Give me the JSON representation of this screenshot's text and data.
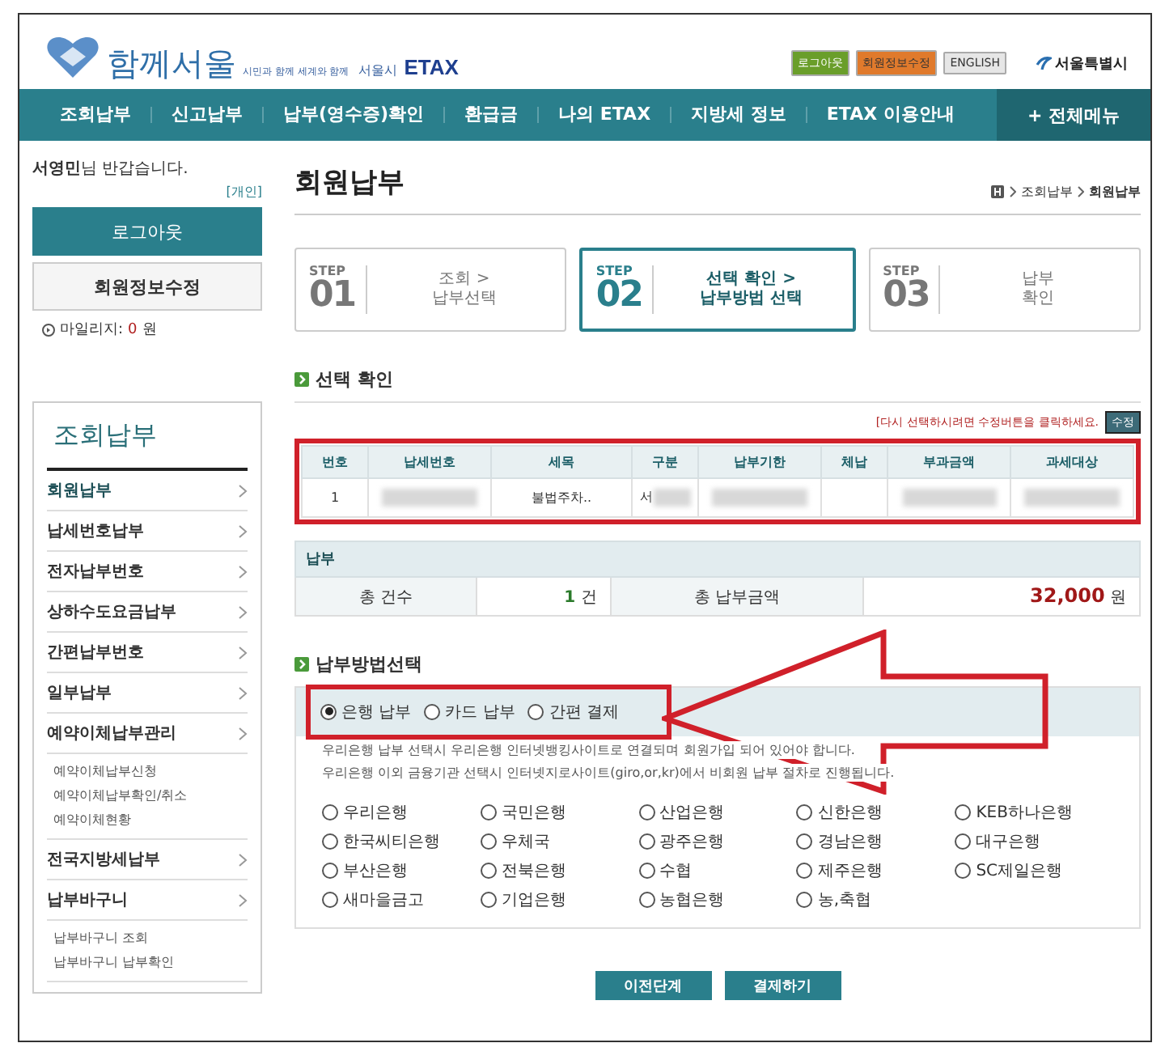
{
  "header": {
    "logo_title": "함께서울",
    "logo_tagline": "시민과 함께 세계와 함께",
    "logo_city": "서울시",
    "logo_brand": "ETAX",
    "top_links": [
      {
        "label": "로그아웃",
        "color": "#6a9e2a"
      },
      {
        "label": "회원정보수정",
        "color": "#e07a2c"
      },
      {
        "label": "ENGLISH",
        "color": "#e6e6e6"
      }
    ],
    "city_logo": "서울특별시"
  },
  "nav": {
    "items": [
      "조회납부",
      "신고납부",
      "납부(영수증)확인",
      "환급금",
      "나의 ETAX",
      "지방세 정보",
      "ETAX 이용안내"
    ],
    "all_menu": "+ 전체메뉴"
  },
  "sidebar": {
    "greeting": "**서영민**님 반갑습니다.",
    "user_type": "[개인]",
    "logout": "로그아웃",
    "edit_profile": "회원정보수정",
    "mileage_label": "마일리지:",
    "mileage_value": "0",
    "mileage_unit": "원",
    "menu_title": "조회납부",
    "items": [
      {
        "label": "회원납부",
        "selected": true
      },
      {
        "label": "납세번호납부",
        "selected": false
      },
      {
        "label": "전자납부번호",
        "selected": false
      },
      {
        "label": "상하수도요금납부",
        "selected": false
      },
      {
        "label": "간편납부번호",
        "selected": false
      },
      {
        "label": "일부납부",
        "selected": false
      },
      {
        "label": "예약이체납부관리",
        "selected": false,
        "children": [
          {
            "label": "예약이체납부신청"
          },
          {
            "label": "예약이체납부확인/취소"
          },
          {
            "label": "예약이체현황"
          }
        ]
      },
      {
        "label": "전국지방세납부",
        "selected": false
      },
      {
        "label": "납부바구니",
        "selected": false,
        "children": [
          {
            "label": "납부바구니 조회"
          },
          {
            "label": "납부바구니 납부확인"
          }
        ]
      }
    ]
  },
  "content": {
    "title": "회원납부",
    "breadcrumb": [
      "조회납부",
      "회원납부"
    ],
    "steps": [
      {
        "step": "STEP",
        "number": "01",
        "label": "조회 >\n납부선택",
        "selected": false
      },
      {
        "step": "STEP",
        "number": "02",
        "label": "선택 확인 >\n납부방법 선택",
        "selected": true
      },
      {
        "step": "STEP",
        "number": "03",
        "label": "납부\n확인",
        "selected": false
      }
    ],
    "selection_title": "선택 확인",
    "edit_notice": "[다시 선택하시려면 수정버튼을 클릭하세요.",
    "edit_button": "수정",
    "table": {
      "columns": [
        "번호",
        "납세번호",
        "세목",
        "구분",
        "납부기한",
        "체납",
        "부과금액",
        "과세대상"
      ],
      "rows": [
        [
          {
            "text": "1"
          },
          {
            "redacted": true
          },
          {
            "text": "불법주차.."
          },
          {
            "text": "서",
            "redacted": true
          },
          {
            "redacted": true
          },
          {
            "redacted": false
          },
          {
            "redacted": true
          },
          {
            "redacted": true
          }
        ]
      ]
    },
    "payment": {
      "title": "납부",
      "count_label": "총 건수",
      "count_value": "1",
      "count_unit": "건",
      "amount_label": "총 납부금액",
      "amount_value": "32,000",
      "amount_unit": "원"
    },
    "method_title": "납부방법선택",
    "methods": [
      {
        "label": "은행 납부",
        "selected": true
      },
      {
        "label": "카드 납부",
        "selected": false
      },
      {
        "label": "간편 결제",
        "selected": false
      }
    ],
    "notes": [
      "우리은행 납부 선택시 우리은행 인터넷뱅킹사이트로 연결되며 회원가입 되어 있어야 합니다.",
      "우리은행 이외 금융기관 선택시 인터넷지로사이트(giro,or,kr)에서 비회원 납부 절차로 진행됩니다."
    ],
    "banks": [
      {
        "label": "우리은행",
        "selected": false
      },
      {
        "label": "국민은행",
        "selected": false
      },
      {
        "label": "산업은행",
        "selected": false
      },
      {
        "label": "신한은행",
        "selected": false
      },
      {
        "label": "KEB하나은행",
        "selected": false
      },
      {
        "label": "한국씨티은행",
        "selected": false
      },
      {
        "label": "우체국",
        "selected": false
      },
      {
        "label": "광주은행",
        "selected": false
      },
      {
        "label": "경남은행",
        "selected": false
      },
      {
        "label": "대구은행",
        "selected": false
      },
      {
        "label": "부산은행",
        "selected": false
      },
      {
        "label": "전북은행",
        "selected": false
      },
      {
        "label": "수협",
        "selected": false
      },
      {
        "label": "제주은행",
        "selected": false
      },
      {
        "label": "SC제일은행",
        "selected": false
      },
      {
        "label": "새마을금고",
        "selected": false
      },
      {
        "label": "기업은행",
        "selected": false
      },
      {
        "label": "농협은행",
        "selected": false
      },
      {
        "label": "농,축협",
        "selected": false
      }
    ],
    "buttons": [
      "이전단계",
      "결제하기"
    ]
  }
}
